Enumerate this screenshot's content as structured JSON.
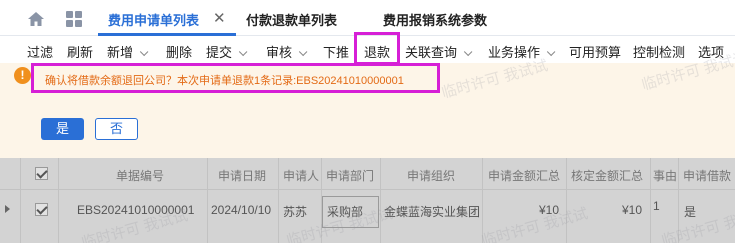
{
  "tabs": {
    "items": [
      {
        "label": "费用申请单列表",
        "active": true
      },
      {
        "label": "付款退款单列表",
        "active": false
      },
      {
        "label": "费用报销系统参数",
        "active": false
      }
    ],
    "close_symbol": "✕"
  },
  "toolbar": {
    "items": [
      {
        "label": "过滤",
        "dropdown": false
      },
      {
        "label": "刷新",
        "dropdown": false
      },
      {
        "label": "新增",
        "dropdown": true
      },
      {
        "label": "删除",
        "dropdown": false
      },
      {
        "label": "提交",
        "dropdown": true
      },
      {
        "label": "审核",
        "dropdown": true
      },
      {
        "label": "下推",
        "dropdown": false
      },
      {
        "label": "退款",
        "dropdown": false,
        "highlighted": true
      },
      {
        "label": "关联查询",
        "dropdown": true
      },
      {
        "label": "业务操作",
        "dropdown": true
      },
      {
        "label": "可用预算",
        "dropdown": false
      },
      {
        "label": "控制检测",
        "dropdown": false
      },
      {
        "label": "选项",
        "dropdown": false
      }
    ]
  },
  "dialog": {
    "icon": "warning-icon",
    "icon_glyph": "!",
    "message": "确认将借款余额退回公司？本次申请单退款1条记录:EBS20241010000001",
    "yes_label": "是",
    "no_label": "否"
  },
  "grid": {
    "columns": [
      "单据编号",
      "申请日期",
      "申请人",
      "申请部门",
      "申请组织",
      "申请金额汇总",
      "核定金额汇总",
      "事由",
      "申请借款"
    ],
    "rows": [
      {
        "checked": true,
        "cells": [
          "EBS20241010000001",
          "2024/10/10",
          "苏苏",
          "采购部",
          "金蝶蓝海实业集团",
          "¥10",
          "¥10",
          "1",
          "是"
        ]
      }
    ]
  },
  "watermark": "临时许可 我试试",
  "colors": {
    "accent": "#2a6fd6",
    "highlight": "#d61fd6",
    "warning": "#f0901e",
    "message_text": "#e36a15",
    "message_bg": "#fdf5e8"
  }
}
